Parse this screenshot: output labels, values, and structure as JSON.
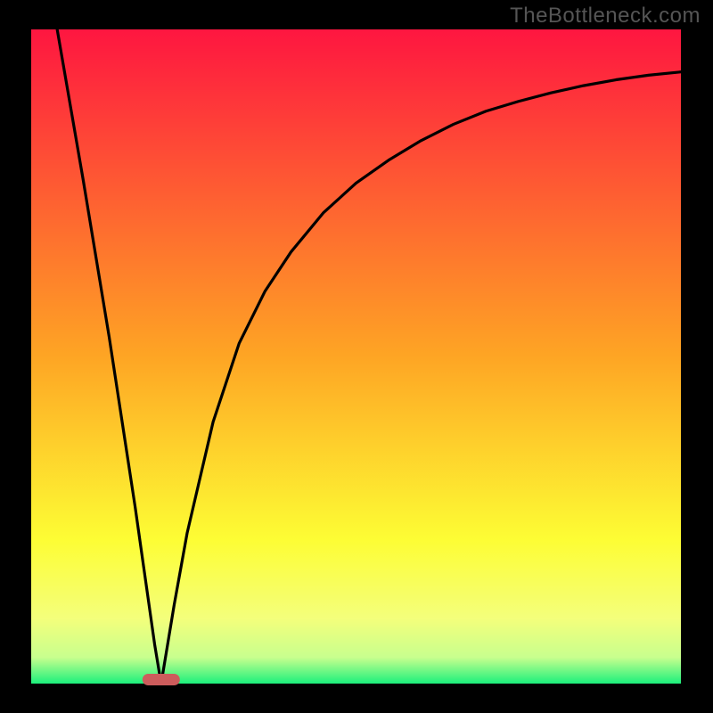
{
  "watermark": "TheBottleneck.com",
  "chart_data": {
    "type": "line",
    "title": "",
    "xlabel": "",
    "ylabel": "",
    "xlim": [
      0,
      100
    ],
    "ylim": [
      0,
      100
    ],
    "notch_x": 20,
    "notch_width": 4,
    "series": [
      {
        "name": "curve",
        "x": [
          4,
          8,
          12,
          16,
          18,
          19,
          20,
          21,
          22,
          24,
          28,
          32,
          36,
          40,
          45,
          50,
          55,
          60,
          65,
          70,
          75,
          80,
          85,
          90,
          95,
          100
        ],
        "y": [
          100,
          77,
          53,
          27,
          13,
          6,
          0,
          6,
          12,
          23,
          40,
          52,
          60,
          66,
          72,
          76.5,
          80,
          83,
          85.5,
          87.5,
          89,
          90.3,
          91.4,
          92.3,
          93,
          93.5
        ]
      }
    ],
    "background_gradient": {
      "stops": [
        {
          "pos": 0.0,
          "color": "#fe1640"
        },
        {
          "pos": 0.5,
          "color": "#fea524"
        },
        {
          "pos": 0.78,
          "color": "#fdfd34"
        },
        {
          "pos": 0.9,
          "color": "#f4ff7b"
        },
        {
          "pos": 0.96,
          "color": "#c8ff8e"
        },
        {
          "pos": 1.0,
          "color": "#1cf07c"
        }
      ]
    },
    "frame": {
      "outer": [
        0,
        0,
        800,
        800
      ],
      "inner": [
        35,
        33,
        729,
        734
      ]
    },
    "marker": {
      "color": "#cd5c5c",
      "x_frac_of_notch": 0.5,
      "width": 42,
      "height": 13
    }
  }
}
